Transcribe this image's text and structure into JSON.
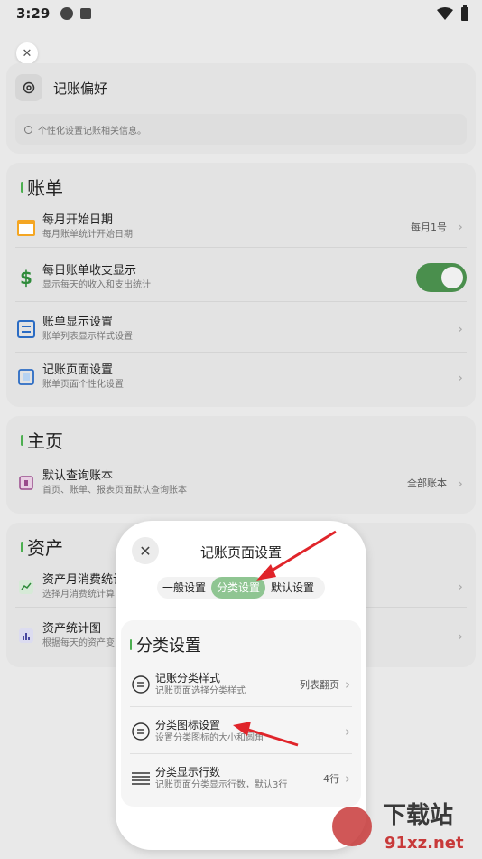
{
  "status_bar": {
    "time": "3:29"
  },
  "preferences": {
    "title": "记账偏好",
    "info": "个性化设置记账相关信息。"
  },
  "bill_section": {
    "title": "账单",
    "items": [
      {
        "title": "每月开始日期",
        "subtitle": "每月账单统计开始日期",
        "value": "每月1号"
      },
      {
        "title": "每日账单收支显示",
        "subtitle": "显示每天的收入和支出统计",
        "toggle": true
      },
      {
        "title": "账单显示设置",
        "subtitle": "账单列表显示样式设置"
      },
      {
        "title": "记账页面设置",
        "subtitle": "账单页面个性化设置"
      }
    ]
  },
  "home_section": {
    "title": "主页",
    "items": [
      {
        "title": "默认查询账本",
        "subtitle": "首页、账单、报表页面默认查询账本",
        "value": "全部账本"
      }
    ]
  },
  "assets_section": {
    "title": "资产",
    "items": [
      {
        "title": "资产月消费统计",
        "subtitle": "选择月消费统计算"
      },
      {
        "title": "资产统计图",
        "subtitle": "根据每天的资产变"
      }
    ]
  },
  "modal": {
    "title": "记账页面设置",
    "tabs": [
      "一般设置",
      "分类设置",
      "默认设置"
    ],
    "active_tab": "分类设置",
    "section_title": "分类设置",
    "items": [
      {
        "title": "记账分类样式",
        "subtitle": "记账页面选择分类样式",
        "value": "列表翻页"
      },
      {
        "title": "分类图标设置",
        "subtitle": "设置分类图标的大小和圆角"
      },
      {
        "title": "分类显示行数",
        "subtitle": "记账页面分类显示行数，默认3行",
        "value": "4行"
      }
    ]
  },
  "watermark": {
    "text1": "下载站",
    "text2": "91xz.net"
  },
  "colors": {
    "accent_green": "#4a8f4d",
    "tab_active": "#8fc592",
    "arrow_red": "#e0242a"
  }
}
